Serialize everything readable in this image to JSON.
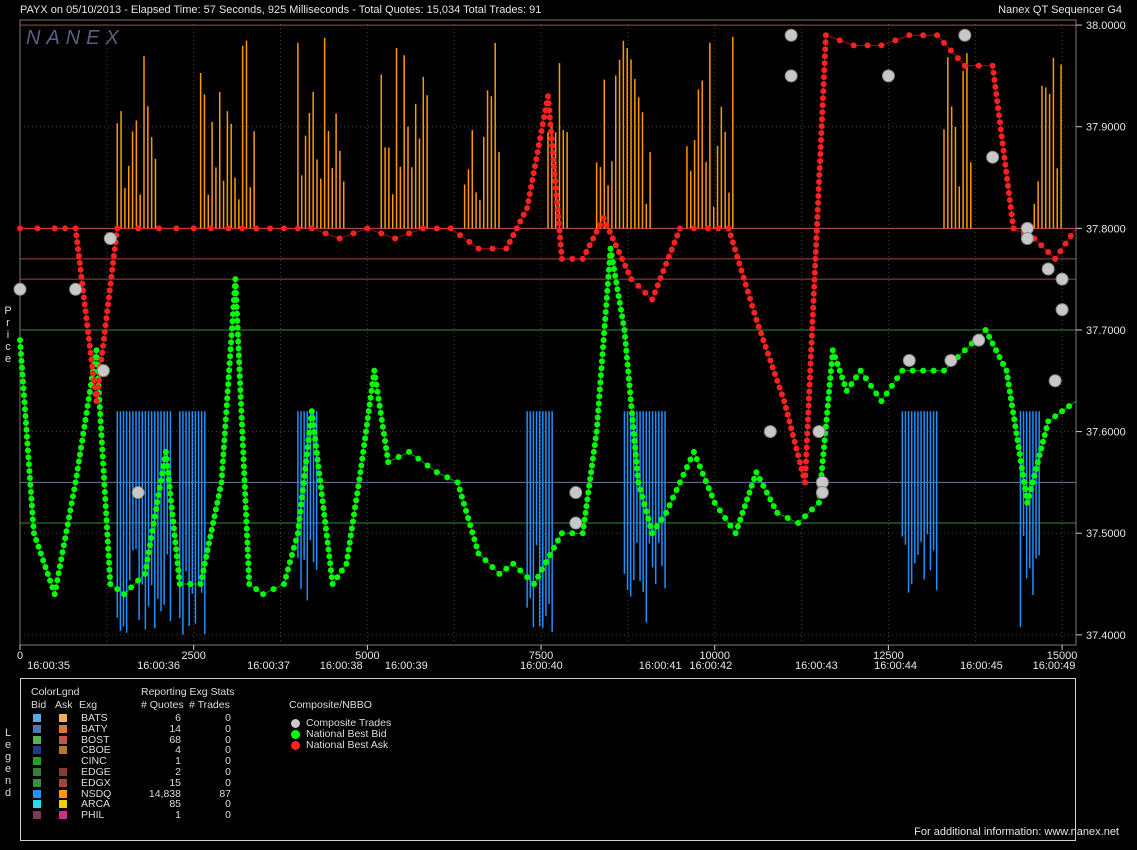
{
  "header": {
    "title_left": "PAYX on 05/10/2013  -  Elapsed Time: 57 Seconds, 925 Milliseconds  -  Total Quotes: 15,034  Total Trades: 91",
    "title_right": "Nanex QT Sequencer G4",
    "watermark": "NANEX",
    "price_axis_label": "Price",
    "legend_side_label": "Legend"
  },
  "chart_data": {
    "type": "line",
    "xlim": [
      0,
      15200
    ],
    "ylim": [
      37.39,
      38.005
    ],
    "y_ticks": [
      "37.4000",
      "37.5000",
      "37.6000",
      "37.7000",
      "37.8000",
      "37.9000",
      "38.0000"
    ],
    "x_ticks": [
      "0",
      "2500",
      "5000",
      "7500",
      "10000",
      "12500",
      "15000"
    ],
    "time_ticks": [
      "16:00:35",
      "16:00:36",
      "16:00:37",
      "16:00:38",
      "16:00:39",
      "16:00:40",
      "16:00:41",
      "16:00:42",
      "16:00:43",
      "16:00:44",
      "16:00:45",
      "16:00:49"
    ],
    "time_tick_x": [
      650,
      3150,
      5650,
      7300,
      8780,
      11850,
      14550,
      15700,
      18100,
      19900,
      21850,
      23500
    ],
    "grid": true,
    "reference_lines": [
      {
        "y": 37.8,
        "color": "#c05050"
      },
      {
        "y": 37.77,
        "color": "#a04848"
      },
      {
        "y": 37.75,
        "color": "#a04848"
      },
      {
        "y": 37.7,
        "color": "#3a8a3a"
      },
      {
        "y": 37.55,
        "color": "#6a7aa0"
      },
      {
        "y": 37.51,
        "color": "#3a8a3a"
      },
      {
        "y": 38.0,
        "color": "#a04848"
      }
    ],
    "series": [
      {
        "name": "National Best Bid",
        "color": "#00ff00",
        "points": [
          [
            0,
            37.69
          ],
          [
            200,
            37.5
          ],
          [
            500,
            37.44
          ],
          [
            800,
            37.55
          ],
          [
            1100,
            37.68
          ],
          [
            1300,
            37.45
          ],
          [
            1500,
            37.44
          ],
          [
            1800,
            37.46
          ],
          [
            2100,
            37.58
          ],
          [
            2300,
            37.45
          ],
          [
            2600,
            37.45
          ],
          [
            2900,
            37.55
          ],
          [
            3100,
            37.75
          ],
          [
            3300,
            37.45
          ],
          [
            3500,
            37.44
          ],
          [
            3800,
            37.45
          ],
          [
            4000,
            37.5
          ],
          [
            4200,
            37.62
          ],
          [
            4500,
            37.45
          ],
          [
            4700,
            37.47
          ],
          [
            4900,
            37.56
          ],
          [
            5100,
            37.66
          ],
          [
            5300,
            37.57
          ],
          [
            5600,
            37.58
          ],
          [
            6000,
            37.56
          ],
          [
            6300,
            37.55
          ],
          [
            6600,
            37.48
          ],
          [
            6900,
            37.46
          ],
          [
            7100,
            37.47
          ],
          [
            7400,
            37.45
          ],
          [
            7800,
            37.5
          ],
          [
            8100,
            37.5
          ],
          [
            8300,
            37.6
          ],
          [
            8500,
            37.78
          ],
          [
            8700,
            37.7
          ],
          [
            8900,
            37.55
          ],
          [
            9100,
            37.5
          ],
          [
            9300,
            37.52
          ],
          [
            9500,
            37.55
          ],
          [
            9700,
            37.58
          ],
          [
            10000,
            37.53
          ],
          [
            10300,
            37.5
          ],
          [
            10600,
            37.56
          ],
          [
            10900,
            37.52
          ],
          [
            11200,
            37.51
          ],
          [
            11500,
            37.53
          ],
          [
            11700,
            37.68
          ],
          [
            11900,
            37.64
          ],
          [
            12100,
            37.66
          ],
          [
            12400,
            37.63
          ],
          [
            12700,
            37.66
          ],
          [
            13000,
            37.66
          ],
          [
            13300,
            37.66
          ],
          [
            13600,
            37.68
          ],
          [
            13900,
            37.7
          ],
          [
            14200,
            37.66
          ],
          [
            14500,
            37.53
          ],
          [
            14800,
            37.61
          ],
          [
            15000,
            37.62
          ],
          [
            15200,
            37.63
          ]
        ]
      },
      {
        "name": "National Best Ask",
        "color": "#ff2020",
        "points": [
          [
            0,
            37.8
          ],
          [
            500,
            37.8
          ],
          [
            800,
            37.8
          ],
          [
            1100,
            37.63
          ],
          [
            1400,
            37.8
          ],
          [
            2000,
            37.8
          ],
          [
            2500,
            37.8
          ],
          [
            3000,
            37.8
          ],
          [
            3400,
            37.8
          ],
          [
            3800,
            37.8
          ],
          [
            4200,
            37.8
          ],
          [
            4600,
            37.79
          ],
          [
            5000,
            37.8
          ],
          [
            5400,
            37.79
          ],
          [
            5800,
            37.8
          ],
          [
            6200,
            37.8
          ],
          [
            6600,
            37.78
          ],
          [
            7000,
            37.78
          ],
          [
            7300,
            37.82
          ],
          [
            7600,
            37.93
          ],
          [
            7800,
            37.77
          ],
          [
            8100,
            37.77
          ],
          [
            8400,
            37.81
          ],
          [
            8800,
            37.75
          ],
          [
            9100,
            37.73
          ],
          [
            9500,
            37.8
          ],
          [
            9900,
            37.8
          ],
          [
            10200,
            37.8
          ],
          [
            10600,
            37.71
          ],
          [
            11000,
            37.63
          ],
          [
            11300,
            37.55
          ],
          [
            11600,
            37.99
          ],
          [
            12000,
            37.98
          ],
          [
            12400,
            37.98
          ],
          [
            12800,
            37.99
          ],
          [
            13200,
            37.99
          ],
          [
            13600,
            37.96
          ],
          [
            14000,
            37.96
          ],
          [
            14300,
            37.8
          ],
          [
            14600,
            37.79
          ],
          [
            14900,
            37.77
          ],
          [
            15200,
            37.8
          ]
        ]
      }
    ],
    "trades": [
      [
        0,
        37.74
      ],
      [
        800,
        37.74
      ],
      [
        1300,
        37.79
      ],
      [
        1200,
        37.66
      ],
      [
        1700,
        37.54
      ],
      [
        8000,
        37.54
      ],
      [
        8000,
        37.51
      ],
      [
        10800,
        37.6
      ],
      [
        11100,
        37.99
      ],
      [
        11100,
        37.95
      ],
      [
        11500,
        37.6
      ],
      [
        11550,
        37.55
      ],
      [
        11550,
        37.54
      ],
      [
        12500,
        37.95
      ],
      [
        12800,
        37.67
      ],
      [
        13400,
        37.67
      ],
      [
        13600,
        37.99
      ],
      [
        14000,
        37.87
      ],
      [
        14500,
        37.8
      ],
      [
        14500,
        37.79
      ],
      [
        14800,
        37.76
      ],
      [
        14900,
        37.65
      ],
      [
        15000,
        37.75
      ],
      [
        15000,
        37.72
      ],
      [
        13800,
        37.69
      ]
    ]
  },
  "legend": {
    "colorlgnd": "ColorLgnd",
    "col_bid": "Bid",
    "col_ask": "Ask",
    "col_exg": "Exg",
    "stats_title": "Reporting Exg Stats",
    "col_quotes": "# Quotes",
    "col_trades": "# Trades",
    "composite_title": "Composite/NBBO",
    "rows": [
      {
        "exg": "BATS",
        "quotes": "6",
        "trades": "0",
        "bid_color": "#5aa8e6",
        "ask_color": "#f0b050"
      },
      {
        "exg": "BATY",
        "quotes": "14",
        "trades": "0",
        "bid_color": "#4a78b0",
        "ask_color": "#e07a2a"
      },
      {
        "exg": "BOST",
        "quotes": "68",
        "trades": "0",
        "bid_color": "#58b050",
        "ask_color": "#c05848"
      },
      {
        "exg": "CBOE",
        "quotes": "4",
        "trades": "0",
        "bid_color": "#1e3a8a",
        "ask_color": "#b87a20"
      },
      {
        "exg": "CINC",
        "quotes": "1",
        "trades": "0",
        "bid_color": "#2a9a2a",
        "ask_color": ""
      },
      {
        "exg": "EDGE",
        "quotes": "2",
        "trades": "0",
        "bid_color": "#3a7a3a",
        "ask_color": "#8a3a2a"
      },
      {
        "exg": "EDGX",
        "quotes": "15",
        "trades": "0",
        "bid_color": "#3a8a4a",
        "ask_color": "#a04838"
      },
      {
        "exg": "NSDQ",
        "quotes": "14,838",
        "trades": "87",
        "bid_color": "#1e90ff",
        "ask_color": "#ff9900"
      },
      {
        "exg": "ARCA",
        "quotes": "85",
        "trades": "0",
        "bid_color": "#20e0f0",
        "ask_color": "#f0d000"
      },
      {
        "exg": "PHIL",
        "quotes": "1",
        "trades": "0",
        "bid_color": "#7a3a5a",
        "ask_color": "#d0308a"
      }
    ],
    "composite": [
      {
        "label": "Composite Trades",
        "color": "#c8c8c8"
      },
      {
        "label": "National Best Bid",
        "color": "#00ff00"
      },
      {
        "label": "National Best Ask",
        "color": "#ff2020"
      }
    ]
  },
  "footer": "For additional information: www.nanex.net"
}
